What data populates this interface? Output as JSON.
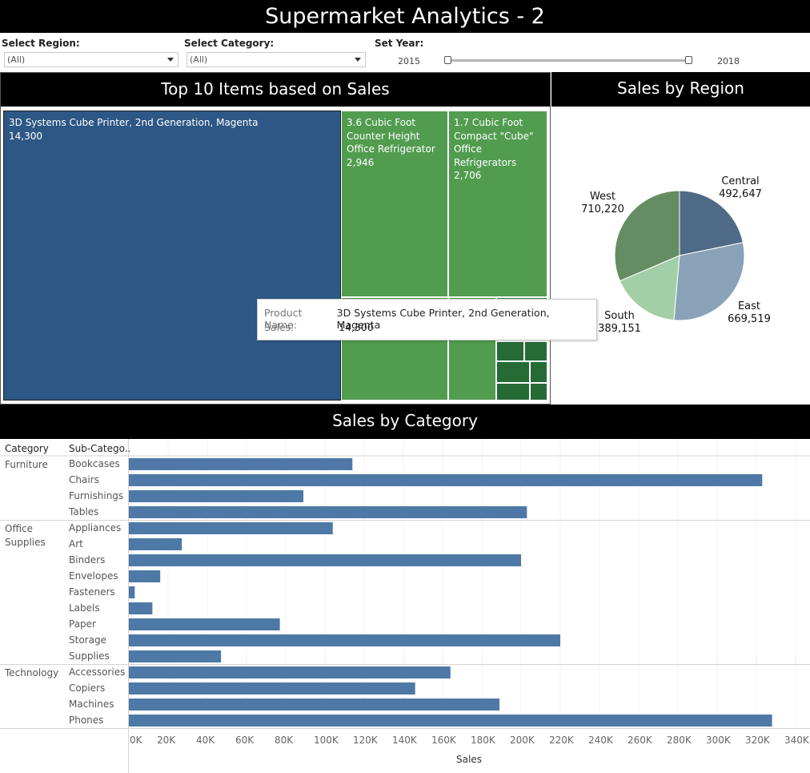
{
  "header": {
    "title": "Supermarket Analytics - 2"
  },
  "filters": {
    "region": {
      "label": "Select Region:",
      "value": "(All)"
    },
    "category": {
      "label": "Select Category:",
      "value": "(All)"
    },
    "year": {
      "label": "Set Year:",
      "start": "2015",
      "end": "2018"
    }
  },
  "treemap": {
    "title": "Top 10 Items based on Sales",
    "items": [
      {
        "name": "3D Systems Cube Printer, 2nd Generation, Magenta",
        "sales": "14,300"
      },
      {
        "name": "3.6 Cubic Foot Counter Height Office Refrigerator",
        "sales": "2,946"
      },
      {
        "name": "1.7 Cubic Foot Compact \"Cube\" Office Refrigerators",
        "sales": "2,706"
      }
    ],
    "tooltip": {
      "product_key": "Product Name:",
      "product_val": "3D Systems Cube Printer, 2nd Generation, Magenta",
      "sales_key": "Sales:",
      "sales_val": "14,300"
    }
  },
  "pie": {
    "title": "Sales by Region",
    "slices": [
      {
        "region": "Central",
        "value": 492647,
        "label": "492,647",
        "color": "#4e6a86"
      },
      {
        "region": "East",
        "value": 669519,
        "label": "669,519",
        "color": "#8aa2b8"
      },
      {
        "region": "South",
        "value": 389151,
        "label": "389,151",
        "color": "#a3cfa6"
      },
      {
        "region": "West",
        "value": 710220,
        "label": "710,220",
        "color": "#668c64"
      }
    ]
  },
  "chart_data": {
    "type": "bar",
    "title": "Sales by Category",
    "col_headers": [
      "Category",
      "Sub-Catego.."
    ],
    "xlabel": "Sales",
    "xlim": [
      0,
      340000
    ],
    "ticks": [
      "0K",
      "20K",
      "40K",
      "60K",
      "80K",
      "100K",
      "120K",
      "140K",
      "160K",
      "180K",
      "200K",
      "220K",
      "240K",
      "260K",
      "280K",
      "300K",
      "320K",
      "340K"
    ],
    "bar_color": "#4e79a7",
    "groups": [
      {
        "category": "Furniture",
        "items": [
          {
            "sub": "Bookcases",
            "value": 114000
          },
          {
            "sub": "Chairs",
            "value": 323000
          },
          {
            "sub": "Furnishings",
            "value": 89000
          },
          {
            "sub": "Tables",
            "value": 203000
          }
        ]
      },
      {
        "category": "Office Supplies",
        "items": [
          {
            "sub": "Appliances",
            "value": 104000
          },
          {
            "sub": "Art",
            "value": 27000
          },
          {
            "sub": "Binders",
            "value": 200000
          },
          {
            "sub": "Envelopes",
            "value": 16000
          },
          {
            "sub": "Fasteners",
            "value": 3000
          },
          {
            "sub": "Labels",
            "value": 12000
          },
          {
            "sub": "Paper",
            "value": 77000
          },
          {
            "sub": "Storage",
            "value": 220000
          },
          {
            "sub": "Supplies",
            "value": 47000
          }
        ]
      },
      {
        "category": "Technology",
        "items": [
          {
            "sub": "Accessories",
            "value": 164000
          },
          {
            "sub": "Copiers",
            "value": 146000
          },
          {
            "sub": "Machines",
            "value": 189000
          },
          {
            "sub": "Phones",
            "value": 328000
          }
        ]
      }
    ]
  }
}
